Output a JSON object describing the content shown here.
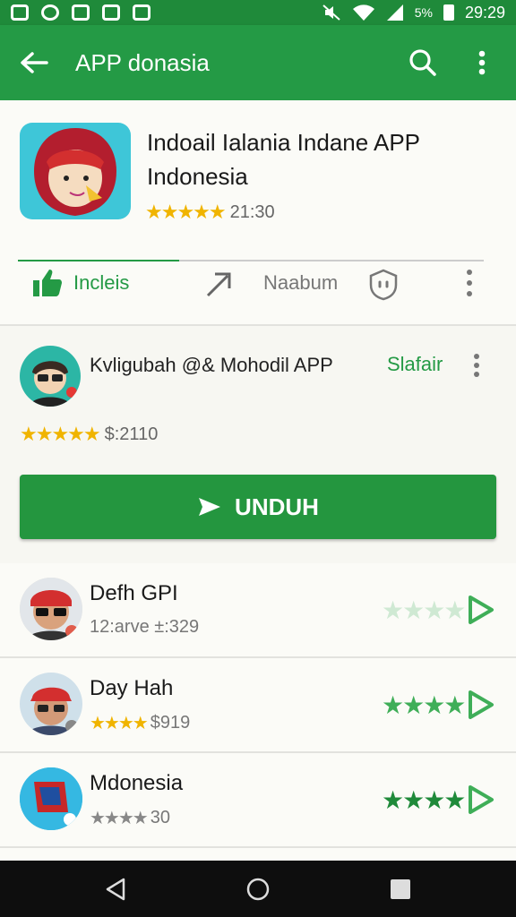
{
  "status_bar": {
    "time": "29:29",
    "battery": "5%"
  },
  "app_bar": {
    "title": "APP donasia"
  },
  "app": {
    "title": "Indoail Ialania Indane APP Indonesia",
    "rating_text": "21:30",
    "stars": "★★★★★"
  },
  "actions": {
    "like_label": "Incleis",
    "share_label": "Naabum"
  },
  "developer": {
    "name": "Kvligubah @& Mohodil APP",
    "link_label": "Slafair",
    "stars": "★★★★★",
    "rating_text": "$:2110",
    "install_label": "UNDUH"
  },
  "list": [
    {
      "title": "Defh GPI",
      "subtitle": "12:arve ±:329",
      "stars": "★★★★",
      "star_color": "#cfe9d3"
    },
    {
      "title": "Day Hah",
      "subtitle": "$919",
      "sub_stars": "★★★★",
      "stars": "★★★★",
      "star_color": "#3fae58"
    },
    {
      "title": "Mdonesia",
      "subtitle": "30",
      "sub_stars": "★★★★",
      "stars": "★★★★",
      "star_color": "#1f8a3a"
    }
  ],
  "colors": {
    "brand_green": "#249a45",
    "star_gold": "#f0b400"
  }
}
